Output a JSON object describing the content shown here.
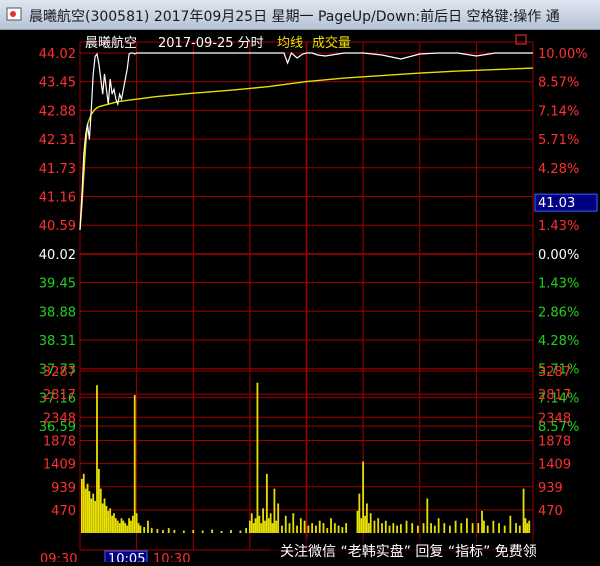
{
  "window": {
    "title": "晨曦航空(300581) 2017年09月25日 星期一 PageUp/Down:前后日 空格键:操作 通"
  },
  "header": {
    "stock_name": "晨曦航空",
    "date_label": "2017-09-25 分时",
    "avg_line_label": "均线",
    "volume_label": "成交量"
  },
  "current_price_tag": "41.03",
  "watermark": "关注微信 “老韩实盘” 回复 “指标” 免费领",
  "colors": {
    "background": "#000000",
    "grid": "#a00000",
    "price_line": "#ffffff",
    "avg_line": "#e8e000",
    "volume_bar": "#e8e000",
    "up": "#ff3030",
    "down": "#20d020",
    "neutral": "#ffffff",
    "label_box": "#000080"
  },
  "chart_data": {
    "type": "line",
    "price_axis": {
      "ticks": [
        "44.02",
        "43.45",
        "42.88",
        "42.31",
        "41.73",
        "41.16",
        "40.59",
        "40.02",
        "39.45",
        "38.88",
        "38.31",
        "37.73",
        "37.16",
        "36.59"
      ],
      "tick_values": [
        44.02,
        43.45,
        42.88,
        42.31,
        41.73,
        41.16,
        40.59,
        40.02,
        39.45,
        38.88,
        38.31,
        37.73,
        37.16,
        36.59
      ],
      "ylim": [
        36.59,
        44.02
      ],
      "pre_close": 40.02
    },
    "pct_axis": {
      "ticks": [
        "10.00%",
        "8.57%",
        "7.14%",
        "5.71%",
        "4.28%",
        "",
        "1.43%",
        "0.00%",
        "1.43%",
        "2.86%",
        "4.28%",
        "5.71%",
        "7.14%",
        "8.57%"
      ]
    },
    "volume_axis": {
      "ticks": [
        "3287",
        "2817",
        "2348",
        "1878",
        "1409",
        "939",
        "470"
      ],
      "tick_values": [
        3287,
        2817,
        2348,
        1878,
        1409,
        939,
        470
      ],
      "ylim": [
        0,
        3287
      ]
    },
    "time_labels": [
      "09:30",
      "10:05",
      "10:30"
    ],
    "highlighted_time": "10:05",
    "series": [
      {
        "key": "price",
        "x": [
          0,
          1,
          2,
          3,
          4,
          5,
          6,
          7,
          8,
          9,
          10,
          11,
          12,
          13,
          14,
          15,
          16,
          17,
          18,
          19,
          20,
          21,
          22,
          23,
          24,
          25,
          26,
          27,
          28,
          29,
          30,
          31,
          32,
          33,
          34,
          35,
          40,
          50,
          60,
          70,
          80,
          90,
          95,
          100,
          105,
          108,
          110,
          112,
          115,
          118,
          120,
          123,
          126,
          130,
          135,
          140,
          150,
          160,
          170,
          180,
          190,
          200,
          210,
          220,
          230,
          238,
          240
        ],
        "y": [
          40.5,
          41.2,
          42.0,
          42.4,
          42.6,
          42.3,
          42.9,
          43.6,
          43.95,
          44.0,
          43.8,
          43.5,
          43.2,
          43.6,
          43.3,
          43.0,
          43.5,
          43.2,
          43.3,
          43.1,
          43.0,
          43.2,
          43.1,
          43.3,
          43.5,
          43.7,
          44.0,
          44.02,
          44.02,
          44.0,
          44.02,
          44.02,
          44.02,
          44.02,
          44.02,
          44.02,
          44.02,
          44.02,
          44.02,
          44.02,
          44.02,
          44.02,
          44.02,
          44.02,
          44.02,
          44.02,
          43.82,
          44.02,
          43.92,
          44.0,
          44.02,
          44.02,
          43.98,
          43.96,
          43.99,
          44.02,
          44.02,
          43.98,
          43.9,
          44.0,
          44.02,
          44.02,
          43.96,
          44.02,
          44.02,
          44.02,
          44.02
        ]
      },
      {
        "key": "average",
        "x": [
          0,
          1,
          2,
          3,
          4,
          6,
          8,
          10,
          15,
          20,
          30,
          40,
          60,
          80,
          100,
          120,
          140,
          160,
          180,
          200,
          220,
          240
        ],
        "y": [
          40.5,
          41.0,
          41.6,
          42.2,
          42.6,
          42.8,
          42.9,
          42.95,
          43.0,
          43.05,
          43.1,
          43.15,
          43.22,
          43.28,
          43.35,
          43.45,
          43.52,
          43.57,
          43.62,
          43.66,
          43.69,
          43.72
        ]
      }
    ],
    "volume_bars": [
      {
        "x": 1,
        "v": 1100
      },
      {
        "x": 2,
        "v": 1200
      },
      {
        "x": 3,
        "v": 900
      },
      {
        "x": 4,
        "v": 1000
      },
      {
        "x": 5,
        "v": 850
      },
      {
        "x": 6,
        "v": 700
      },
      {
        "x": 7,
        "v": 800
      },
      {
        "x": 8,
        "v": 650
      },
      {
        "x": 9,
        "v": 3000
      },
      {
        "x": 10,
        "v": 1300
      },
      {
        "x": 11,
        "v": 900
      },
      {
        "x": 12,
        "v": 600
      },
      {
        "x": 13,
        "v": 700
      },
      {
        "x": 14,
        "v": 550
      },
      {
        "x": 15,
        "v": 450
      },
      {
        "x": 16,
        "v": 500
      },
      {
        "x": 17,
        "v": 350
      },
      {
        "x": 18,
        "v": 400
      },
      {
        "x": 19,
        "v": 300
      },
      {
        "x": 20,
        "v": 250
      },
      {
        "x": 21,
        "v": 200
      },
      {
        "x": 22,
        "v": 300
      },
      {
        "x": 23,
        "v": 250
      },
      {
        "x": 24,
        "v": 200
      },
      {
        "x": 25,
        "v": 150
      },
      {
        "x": 26,
        "v": 300
      },
      {
        "x": 27,
        "v": 250
      },
      {
        "x": 28,
        "v": 350
      },
      {
        "x": 29,
        "v": 2800
      },
      {
        "x": 30,
        "v": 400
      },
      {
        "x": 31,
        "v": 200
      },
      {
        "x": 32,
        "v": 150
      },
      {
        "x": 34,
        "v": 120
      },
      {
        "x": 36,
        "v": 250
      },
      {
        "x": 38,
        "v": 100
      },
      {
        "x": 41,
        "v": 80
      },
      {
        "x": 44,
        "v": 60
      },
      {
        "x": 47,
        "v": 100
      },
      {
        "x": 50,
        "v": 60
      },
      {
        "x": 55,
        "v": 50
      },
      {
        "x": 60,
        "v": 60
      },
      {
        "x": 65,
        "v": 50
      },
      {
        "x": 70,
        "v": 70
      },
      {
        "x": 75,
        "v": 40
      },
      {
        "x": 80,
        "v": 60
      },
      {
        "x": 85,
        "v": 50
      },
      {
        "x": 88,
        "v": 100
      },
      {
        "x": 90,
        "v": 250
      },
      {
        "x": 91,
        "v": 400
      },
      {
        "x": 92,
        "v": 200
      },
      {
        "x": 93,
        "v": 300
      },
      {
        "x": 94,
        "v": 3050
      },
      {
        "x": 95,
        "v": 350
      },
      {
        "x": 96,
        "v": 200
      },
      {
        "x": 97,
        "v": 500
      },
      {
        "x": 98,
        "v": 250
      },
      {
        "x": 99,
        "v": 1200
      },
      {
        "x": 100,
        "v": 300
      },
      {
        "x": 101,
        "v": 400
      },
      {
        "x": 102,
        "v": 200
      },
      {
        "x": 103,
        "v": 900
      },
      {
        "x": 104,
        "v": 250
      },
      {
        "x": 105,
        "v": 600
      },
      {
        "x": 107,
        "v": 150
      },
      {
        "x": 109,
        "v": 350
      },
      {
        "x": 111,
        "v": 200
      },
      {
        "x": 113,
        "v": 400
      },
      {
        "x": 115,
        "v": 150
      },
      {
        "x": 117,
        "v": 300
      },
      {
        "x": 119,
        "v": 250
      },
      {
        "x": 121,
        "v": 150
      },
      {
        "x": 123,
        "v": 200
      },
      {
        "x": 125,
        "v": 150
      },
      {
        "x": 127,
        "v": 250
      },
      {
        "x": 129,
        "v": 200
      },
      {
        "x": 131,
        "v": 100
      },
      {
        "x": 133,
        "v": 300
      },
      {
        "x": 135,
        "v": 200
      },
      {
        "x": 137,
        "v": 150
      },
      {
        "x": 139,
        "v": 120
      },
      {
        "x": 141,
        "v": 200
      },
      {
        "x": 147,
        "v": 450
      },
      {
        "x": 148,
        "v": 800
      },
      {
        "x": 149,
        "v": 300
      },
      {
        "x": 150,
        "v": 1450
      },
      {
        "x": 151,
        "v": 350
      },
      {
        "x": 152,
        "v": 600
      },
      {
        "x": 153,
        "v": 200
      },
      {
        "x": 154,
        "v": 400
      },
      {
        "x": 156,
        "v": 250
      },
      {
        "x": 158,
        "v": 300
      },
      {
        "x": 160,
        "v": 200
      },
      {
        "x": 162,
        "v": 250
      },
      {
        "x": 164,
        "v": 150
      },
      {
        "x": 166,
        "v": 200
      },
      {
        "x": 168,
        "v": 150
      },
      {
        "x": 170,
        "v": 180
      },
      {
        "x": 173,
        "v": 250
      },
      {
        "x": 176,
        "v": 200
      },
      {
        "x": 179,
        "v": 150
      },
      {
        "x": 182,
        "v": 200
      },
      {
        "x": 184,
        "v": 700
      },
      {
        "x": 186,
        "v": 200
      },
      {
        "x": 188,
        "v": 150
      },
      {
        "x": 190,
        "v": 300
      },
      {
        "x": 193,
        "v": 200
      },
      {
        "x": 196,
        "v": 150
      },
      {
        "x": 199,
        "v": 250
      },
      {
        "x": 202,
        "v": 200
      },
      {
        "x": 205,
        "v": 300
      },
      {
        "x": 208,
        "v": 200
      },
      {
        "x": 211,
        "v": 200
      },
      {
        "x": 213,
        "v": 450
      },
      {
        "x": 214,
        "v": 250
      },
      {
        "x": 216,
        "v": 150
      },
      {
        "x": 219,
        "v": 250
      },
      {
        "x": 222,
        "v": 200
      },
      {
        "x": 225,
        "v": 150
      },
      {
        "x": 228,
        "v": 350
      },
      {
        "x": 231,
        "v": 200
      },
      {
        "x": 233,
        "v": 150
      },
      {
        "x": 235,
        "v": 900
      },
      {
        "x": 236,
        "v": 300
      },
      {
        "x": 237,
        "v": 200
      },
      {
        "x": 238,
        "v": 250
      }
    ]
  }
}
